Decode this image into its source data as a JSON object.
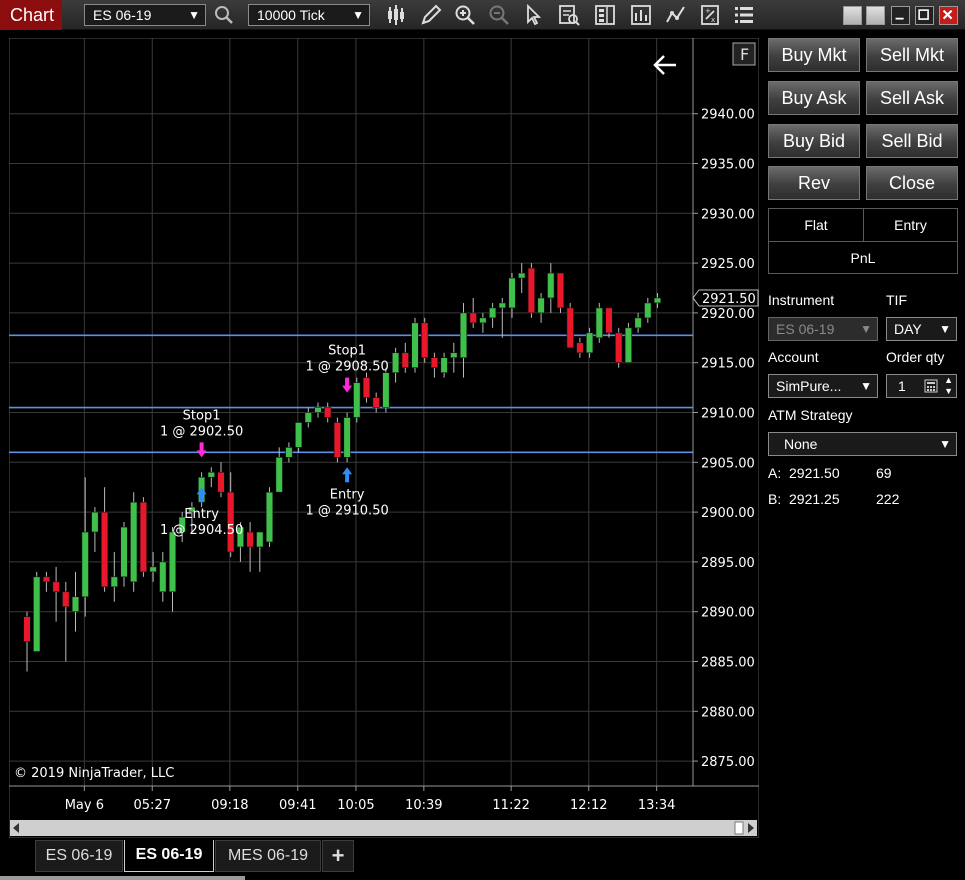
{
  "window": {
    "title": "Chart",
    "instrument_selector": "ES 06-19",
    "interval_selector": "10000 Tick"
  },
  "toolbar_icons": [
    "search-icon",
    "candlestick-icon",
    "pencil-icon",
    "zoom-in-icon",
    "zoom-out-icon",
    "pointer-icon",
    "data-box-icon",
    "chart-trader-icon",
    "indicators-icon",
    "strategies-icon",
    "templates-icon",
    "menu-icon"
  ],
  "chart": {
    "flag_label": "F",
    "copyright": "© 2019 NinjaTrader, LLC",
    "back_icon": "arrow-left-icon"
  },
  "chart_data": {
    "type": "candlestick",
    "y_ticks": [
      "2940.00",
      "2935.00",
      "2930.00",
      "2925.00",
      "2920.00",
      "2915.00",
      "2910.00",
      "2905.00",
      "2900.00",
      "2895.00",
      "2890.00",
      "2885.00",
      "2880.00",
      "2875.00"
    ],
    "y_range": [
      2872.5,
      2947.5
    ],
    "x_ticks": [
      "May 6",
      "05:27",
      "09:18",
      "09:41",
      "10:05",
      "10:39",
      "11:22",
      "12:12",
      "13:34"
    ],
    "last_price": "2921.50",
    "horizontal_lines": [
      2917.75,
      2910.5,
      2906.0
    ],
    "candles": [
      {
        "o": 2889.5,
        "h": 2890.0,
        "l": 2884.0,
        "c": 2887.0
      },
      {
        "o": 2886.0,
        "h": 2894.0,
        "l": 2886.0,
        "c": 2893.5
      },
      {
        "o": 2893.5,
        "h": 2894.0,
        "l": 2892.0,
        "c": 2893.0
      },
      {
        "o": 2893.0,
        "h": 2894.5,
        "l": 2889.0,
        "c": 2892.0
      },
      {
        "o": 2892.0,
        "h": 2893.0,
        "l": 2885.0,
        "c": 2890.5
      },
      {
        "o": 2890.0,
        "h": 2894.0,
        "l": 2888.0,
        "c": 2891.5
      },
      {
        "o": 2891.5,
        "h": 2903.5,
        "l": 2889.5,
        "c": 2898.0
      },
      {
        "o": 2898.0,
        "h": 2900.5,
        "l": 2896.0,
        "c": 2900.0
      },
      {
        "o": 2900.0,
        "h": 2902.5,
        "l": 2892.0,
        "c": 2892.5
      },
      {
        "o": 2892.5,
        "h": 2896.0,
        "l": 2891.0,
        "c": 2893.5
      },
      {
        "o": 2893.5,
        "h": 2899.0,
        "l": 2892.5,
        "c": 2898.5
      },
      {
        "o": 2893.0,
        "h": 2902.0,
        "l": 2892.0,
        "c": 2901.0
      },
      {
        "o": 2901.0,
        "h": 2901.5,
        "l": 2893.5,
        "c": 2894.0
      },
      {
        "o": 2894.0,
        "h": 2896.0,
        "l": 2893.0,
        "c": 2894.5
      },
      {
        "o": 2892.0,
        "h": 2896.0,
        "l": 2891.0,
        "c": 2895.0
      },
      {
        "o": 2892.0,
        "h": 2898.5,
        "l": 2890.0,
        "c": 2898.0
      },
      {
        "o": 2898.0,
        "h": 2900.0,
        "l": 2897.0,
        "c": 2899.5
      },
      {
        "o": 2900.0,
        "h": 2901.0,
        "l": 2898.0,
        "c": 2900.5
      },
      {
        "o": 2901.0,
        "h": 2904.0,
        "l": 2900.5,
        "c": 2903.5
      },
      {
        "o": 2903.5,
        "h": 2904.5,
        "l": 2902.5,
        "c": 2904.0
      },
      {
        "o": 2904.0,
        "h": 2905.0,
        "l": 2901.5,
        "c": 2902.0
      },
      {
        "o": 2902.0,
        "h": 2904.0,
        "l": 2895.5,
        "c": 2896.0
      },
      {
        "o": 2896.5,
        "h": 2899.0,
        "l": 2895.0,
        "c": 2898.5
      },
      {
        "o": 2898.0,
        "h": 2899.0,
        "l": 2894.0,
        "c": 2896.5
      },
      {
        "o": 2896.5,
        "h": 2898.0,
        "l": 2894.0,
        "c": 2898.0
      },
      {
        "o": 2897.0,
        "h": 2902.5,
        "l": 2896.5,
        "c": 2902.0
      },
      {
        "o": 2902.0,
        "h": 2906.5,
        "l": 2902.0,
        "c": 2905.5
      },
      {
        "o": 2905.5,
        "h": 2907.0,
        "l": 2905.0,
        "c": 2906.5
      },
      {
        "o": 2906.5,
        "h": 2909.0,
        "l": 2906.0,
        "c": 2909.0
      },
      {
        "o": 2909.0,
        "h": 2910.5,
        "l": 2908.5,
        "c": 2910.0
      },
      {
        "o": 2910.0,
        "h": 2911.0,
        "l": 2909.5,
        "c": 2910.5
      },
      {
        "o": 2910.5,
        "h": 2911.0,
        "l": 2909.0,
        "c": 2909.5
      },
      {
        "o": 2909.0,
        "h": 2909.5,
        "l": 2905.0,
        "c": 2905.5
      },
      {
        "o": 2905.5,
        "h": 2910.0,
        "l": 2905.0,
        "c": 2909.5
      },
      {
        "o": 2909.5,
        "h": 2913.5,
        "l": 2909.0,
        "c": 2913.0
      },
      {
        "o": 2913.5,
        "h": 2914.0,
        "l": 2911.0,
        "c": 2911.5
      },
      {
        "o": 2911.5,
        "h": 2912.0,
        "l": 2910.0,
        "c": 2910.5
      },
      {
        "o": 2910.5,
        "h": 2914.5,
        "l": 2910.0,
        "c": 2914.0
      },
      {
        "o": 2914.0,
        "h": 2916.5,
        "l": 2913.0,
        "c": 2916.0
      },
      {
        "o": 2916.0,
        "h": 2917.0,
        "l": 2914.0,
        "c": 2914.5
      },
      {
        "o": 2914.5,
        "h": 2919.5,
        "l": 2914.0,
        "c": 2919.0
      },
      {
        "o": 2919.0,
        "h": 2919.5,
        "l": 2915.0,
        "c": 2915.5
      },
      {
        "o": 2915.5,
        "h": 2916.0,
        "l": 2913.5,
        "c": 2914.5
      },
      {
        "o": 2914.0,
        "h": 2916.0,
        "l": 2913.5,
        "c": 2915.5
      },
      {
        "o": 2915.5,
        "h": 2917.0,
        "l": 2914.0,
        "c": 2916.0
      },
      {
        "o": 2915.5,
        "h": 2921.0,
        "l": 2913.5,
        "c": 2920.0
      },
      {
        "o": 2920.0,
        "h": 2921.5,
        "l": 2918.5,
        "c": 2919.0
      },
      {
        "o": 2919.0,
        "h": 2920.0,
        "l": 2918.0,
        "c": 2919.5
      },
      {
        "o": 2919.5,
        "h": 2921.0,
        "l": 2918.5,
        "c": 2920.5
      },
      {
        "o": 2920.5,
        "h": 2921.5,
        "l": 2917.5,
        "c": 2921.0
      },
      {
        "o": 2920.5,
        "h": 2924.0,
        "l": 2919.5,
        "c": 2923.5
      },
      {
        "o": 2923.5,
        "h": 2925.0,
        "l": 2922.0,
        "c": 2924.0
      },
      {
        "o": 2924.5,
        "h": 2925.0,
        "l": 2919.5,
        "c": 2920.0
      },
      {
        "o": 2920.0,
        "h": 2922.0,
        "l": 2919.0,
        "c": 2921.5
      },
      {
        "o": 2921.5,
        "h": 2925.0,
        "l": 2920.0,
        "c": 2924.0
      },
      {
        "o": 2924.0,
        "h": 2924.0,
        "l": 2920.0,
        "c": 2920.5
      },
      {
        "o": 2920.5,
        "h": 2921.0,
        "l": 2916.5,
        "c": 2916.5
      },
      {
        "o": 2917.0,
        "h": 2917.5,
        "l": 2915.5,
        "c": 2916.0
      },
      {
        "o": 2916.0,
        "h": 2918.5,
        "l": 2915.5,
        "c": 2918.0
      },
      {
        "o": 2917.5,
        "h": 2921.0,
        "l": 2917.0,
        "c": 2920.5
      },
      {
        "o": 2920.5,
        "h": 2920.5,
        "l": 2917.5,
        "c": 2918.0
      },
      {
        "o": 2918.0,
        "h": 2918.5,
        "l": 2914.5,
        "c": 2915.0
      },
      {
        "o": 2915.0,
        "h": 2919.0,
        "l": 2915.0,
        "c": 2918.5
      },
      {
        "o": 2918.5,
        "h": 2920.0,
        "l": 2918.0,
        "c": 2919.5
      },
      {
        "o": 2919.5,
        "h": 2921.5,
        "l": 2919.0,
        "c": 2921.0
      },
      {
        "o": 2921.0,
        "h": 2922.0,
        "l": 2920.5,
        "c": 2921.5
      }
    ],
    "annotations": [
      {
        "name": "Stop1",
        "label": "1 @ 2902.50",
        "kind": "stop",
        "candle": 18,
        "price": 2905.5
      },
      {
        "name": "Entry",
        "label": "1 @ 2904.50",
        "kind": "entry",
        "candle": 18,
        "price": 2902.5
      },
      {
        "name": "Stop1",
        "label": "1 @ 2908.50",
        "kind": "stop",
        "candle": 33,
        "price": 2912.0
      },
      {
        "name": "Entry",
        "label": "1 @ 2910.50",
        "kind": "entry",
        "candle": 33,
        "price": 2904.5
      }
    ]
  },
  "tabs": [
    {
      "label": "ES 06-19",
      "active": false
    },
    {
      "label": "ES 06-19",
      "active": true
    },
    {
      "label": "MES 06-19",
      "active": false
    }
  ],
  "add_tab_label": "+",
  "chart_trader": {
    "buttons": [
      "Buy Mkt",
      "Sell Mkt",
      "Buy Ask",
      "Sell Ask",
      "Buy Bid",
      "Sell Bid",
      "Rev",
      "Close"
    ],
    "position": {
      "flat": "Flat",
      "entry": "Entry",
      "pnl": "PnL"
    },
    "instrument_label": "Instrument",
    "instrument_value": "ES 06-19",
    "tif_label": "TIF",
    "tif_value": "DAY",
    "account_label": "Account",
    "account_value": "SimPure...",
    "order_qty_label": "Order qty",
    "order_qty_value": "1",
    "atm_label": "ATM Strategy",
    "atm_value": "None",
    "ask_label": "A:",
    "ask_price": "2921.50",
    "ask_size": "69",
    "bid_label": "B:",
    "bid_price": "2921.25",
    "bid_size": "222"
  }
}
